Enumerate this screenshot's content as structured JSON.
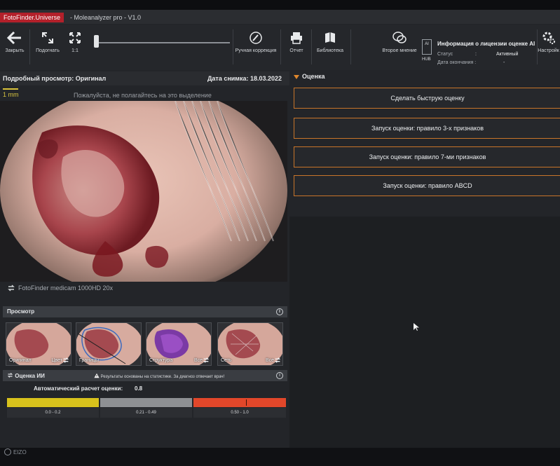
{
  "window": {
    "brand": "FotoFinder.Universe",
    "app_title": "- Moleanalyzer pro - V1.0"
  },
  "toolbar": {
    "close": "Закрыть",
    "fit": "Подогнать",
    "one_to_one": "1:1",
    "manual_correction": "Ручная коррекция",
    "report": "Отчет",
    "library": "Библиотека",
    "second_opinion": "Второе мнение",
    "settings": "Настройк"
  },
  "license": {
    "ai_badge": "AI",
    "hub": "HUB",
    "title": "Информация о лицензии оценке AI",
    "status_label": "Статус",
    "status_colon": ":",
    "status_value": "Активный",
    "expiry_label": "Дата окончания :",
    "expiry_value": "-"
  },
  "view": {
    "title": "Подробный просмотр: Оригинал",
    "date_label": "Дата снимка: 18.03.2022",
    "scale": "1 mm",
    "hint": "Пожалуйста, не полагайтесь на это выделение",
    "camera": "FotoFinder medicam 1000HD 20x"
  },
  "preview": {
    "title": "Просмотр",
    "info": "i",
    "thumbs": [
      {
        "label": "Оригинал",
        "sub": "Цвет"
      },
      {
        "label": "Границы",
        "sub": ""
      },
      {
        "label": "Структура",
        "sub": "Все"
      },
      {
        "label": "Сеть",
        "sub": "Все"
      }
    ]
  },
  "ai": {
    "title": "Оценка ИИ",
    "warning": "Результаты основаны на статистике. За диагноз отвечает врач!",
    "info": "i",
    "auto_label": "Автоматический расчет оценки:",
    "auto_value": "0.8",
    "score": 0.8,
    "ranges": [
      {
        "label": "0.0 - 0.2",
        "color": "#d8c21c"
      },
      {
        "label": "0.21 - 0.49",
        "color": "#8e9093"
      },
      {
        "label": "0.50 - 1.0",
        "color": "#e2472a"
      }
    ]
  },
  "assessment": {
    "title": "Оценка",
    "buttons": [
      "Сделать быструю оценку",
      "Запуск оценки: правило 3-х признаков",
      "Запуск оценки: правило 7-ми признаков",
      "Запуск оценки: правило ABCD"
    ]
  },
  "colors": {
    "accent": "#c8752a",
    "brand": "#b3202a"
  }
}
